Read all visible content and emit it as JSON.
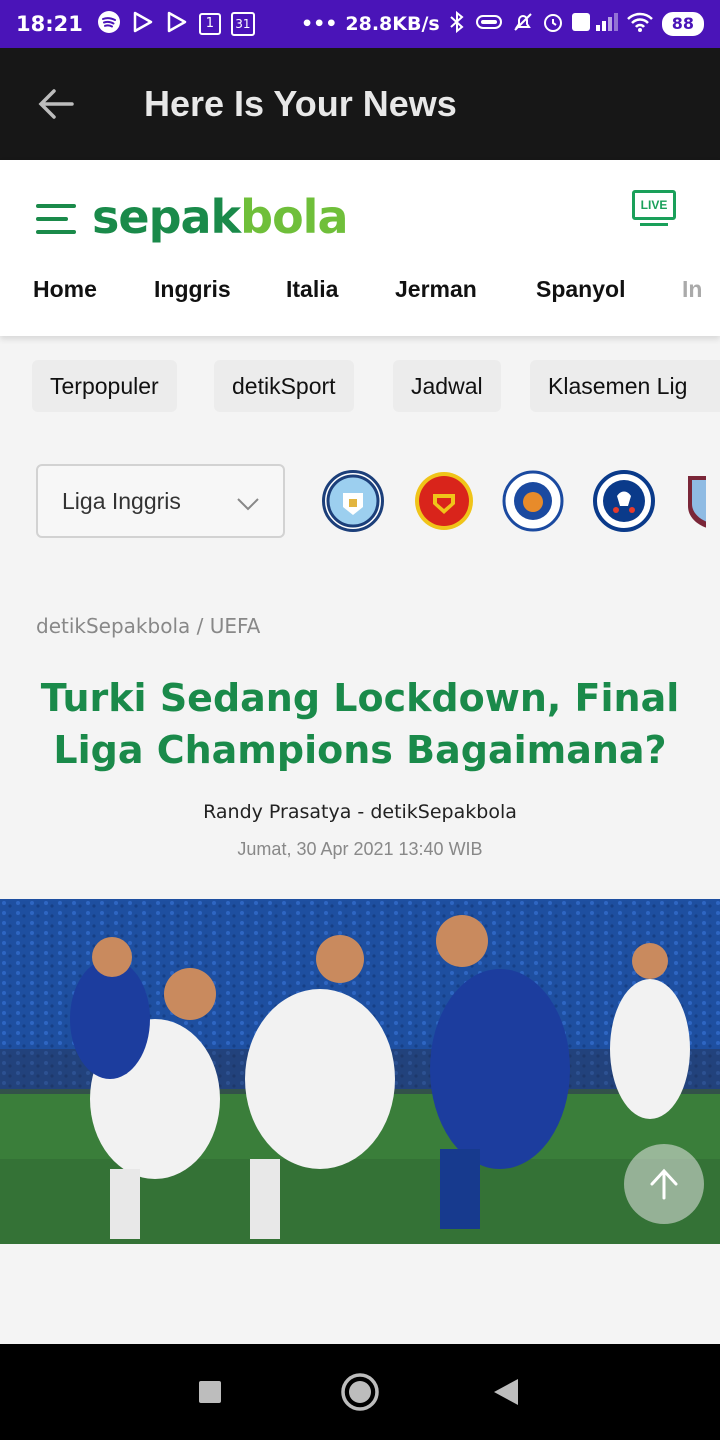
{
  "status_bar": {
    "time": "18:21",
    "net_speed": "28.8KB/s",
    "battery": "88",
    "calendar_day": "31",
    "sim_badge": "1",
    "dots": "•••"
  },
  "app_bar": {
    "title": "Here Is Your News"
  },
  "site": {
    "logo_main": "sepak",
    "logo_accent": "bola",
    "live_label": "LIVE",
    "nav": [
      "Home",
      "Inggris",
      "Italia",
      "Jerman",
      "Spanyol",
      "In"
    ],
    "chips": [
      "Terpopuler",
      "detikSport",
      "Jadwal",
      "Klasemen Lig"
    ]
  },
  "league_select": {
    "value": "Liga Inggris"
  },
  "clubs": [
    "manchester-city-crest",
    "manchester-united-crest",
    "leicester-city-crest",
    "chelsea-crest",
    "west-ham-crest"
  ],
  "article": {
    "breadcrumb": "detikSepakbola / UEFA",
    "headline": "Turki Sedang Lockdown, Final Liga Champions Bagaimana?",
    "author": "Randy Prasatya - detikSepakbola",
    "date": "Jumat, 30 Apr 2021 13:40 WIB"
  },
  "colors": {
    "status_bar": "#4a14b8",
    "app_bar": "#171717",
    "brand_green": "#1a8a4a",
    "brand_light_green": "#6fbf3a"
  }
}
